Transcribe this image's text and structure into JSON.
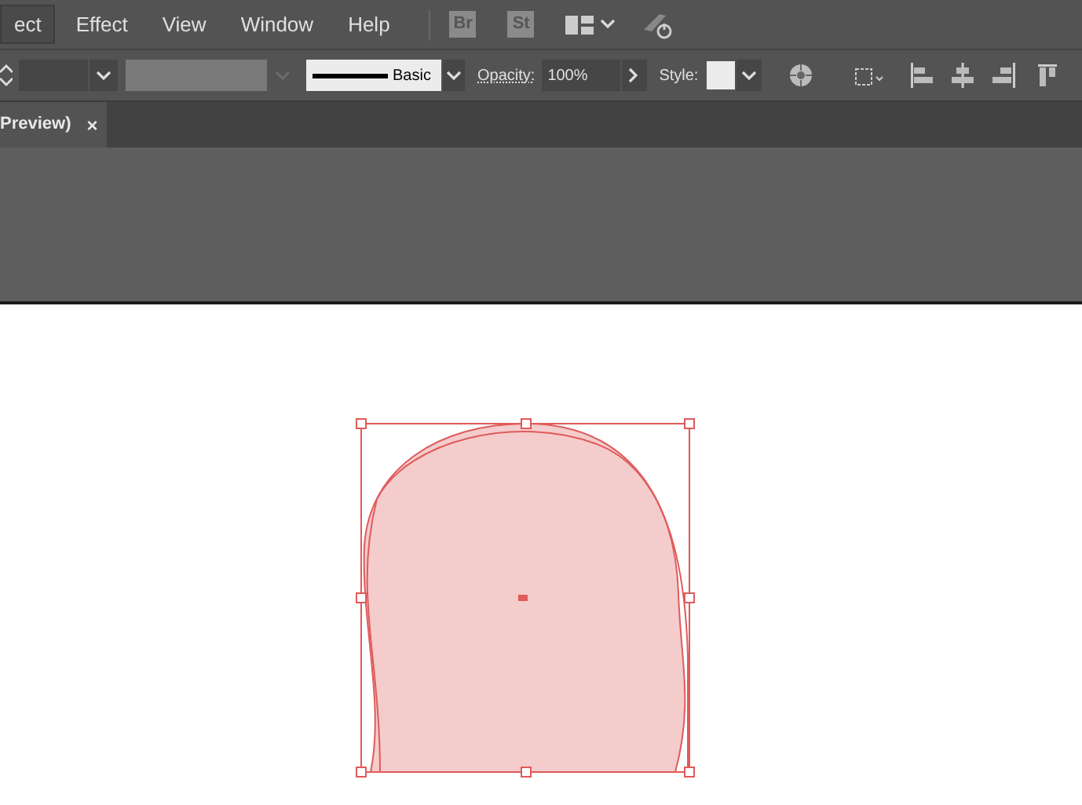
{
  "menu": [
    {
      "label": "ect",
      "selected": true
    },
    {
      "label": "Effect",
      "selected": false
    },
    {
      "label": "View",
      "selected": false
    },
    {
      "label": "Window",
      "selected": false
    },
    {
      "label": "Help",
      "selected": false
    }
  ],
  "app_badges": [
    "Br",
    "St"
  ],
  "control_bar": {
    "stroke_profile": "Basic",
    "opacity_label": "Opacity:",
    "opacity_value": "100%",
    "style_label": "Style:"
  },
  "document_tab": {
    "title": "Preview)",
    "close": "×"
  }
}
